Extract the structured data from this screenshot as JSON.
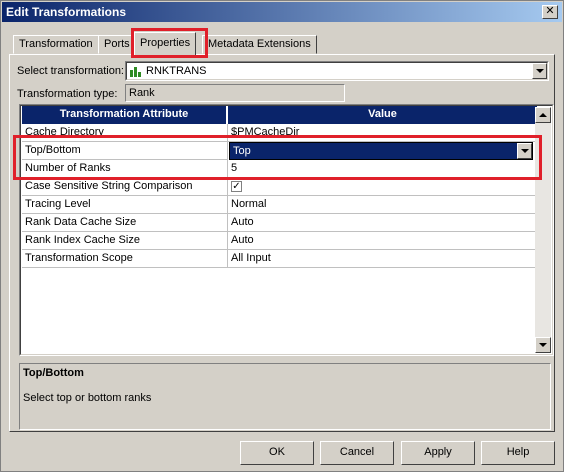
{
  "window": {
    "title": "Edit Transformations",
    "close_glyph": "✕"
  },
  "tabs": [
    {
      "label": "Transformation"
    },
    {
      "label": "Ports"
    },
    {
      "label": "Properties"
    },
    {
      "label": "Metadata Extensions"
    }
  ],
  "select_transformation": {
    "label": "Select transformation:",
    "value": "RNKTRANS",
    "icon": "rank-transformation-icon"
  },
  "transformation_type": {
    "label": "Transformation type:",
    "value": "Rank"
  },
  "grid": {
    "headers": [
      "Transformation Attribute",
      "Value"
    ],
    "rows": [
      {
        "attribute": "Cache Directory",
        "value": "$PMCacheDir"
      },
      {
        "attribute": "Top/Bottom",
        "value": "Top"
      },
      {
        "attribute": "Number of Ranks",
        "value": "5"
      },
      {
        "attribute": "Case Sensitive String Comparison",
        "value": "✓"
      },
      {
        "attribute": "Tracing Level",
        "value": "Normal"
      },
      {
        "attribute": "Rank Data Cache Size",
        "value": "Auto"
      },
      {
        "attribute": "Rank Index Cache Size",
        "value": "Auto"
      },
      {
        "attribute": "Transformation Scope",
        "value": "All Input"
      }
    ]
  },
  "description": {
    "title": "Top/Bottom",
    "text": "Select top or bottom ranks"
  },
  "buttons": {
    "ok": "OK",
    "cancel": "Cancel",
    "apply": "Apply",
    "help": "Help"
  },
  "colors": {
    "highlight": "#e0202a",
    "selection": "#0a246a"
  }
}
